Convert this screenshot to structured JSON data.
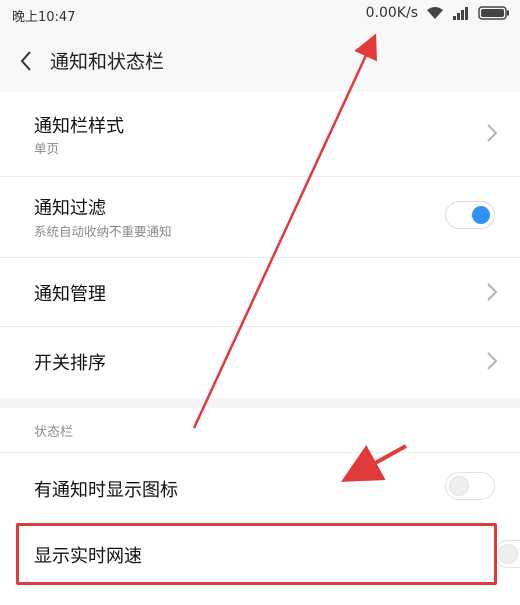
{
  "status_bar": {
    "time": "晚上10:47",
    "net_speed": "0.00K/s",
    "icons": [
      "wifi-icon",
      "signal-icon",
      "battery-icon"
    ]
  },
  "header": {
    "title": "通知和状态栏"
  },
  "notification_section": {
    "items": [
      {
        "label": "通知栏样式",
        "sub": "单页",
        "control": "chevron"
      },
      {
        "label": "通知过滤",
        "sub": "系统自动收纳不重要通知",
        "control": "toggle",
        "state": "on"
      },
      {
        "label": "通知管理",
        "control": "chevron"
      },
      {
        "label": "开关排序",
        "control": "chevron"
      }
    ]
  },
  "status_section": {
    "header": "状态栏",
    "items": [
      {
        "label": "有通知时显示图标",
        "control": "toggle",
        "state": "off"
      },
      {
        "label": "显示实时网速",
        "control": "toggle",
        "highlighted": true
      }
    ]
  },
  "colors": {
    "accent": "#2f93f2",
    "annotation_red": "#e23a3a"
  }
}
